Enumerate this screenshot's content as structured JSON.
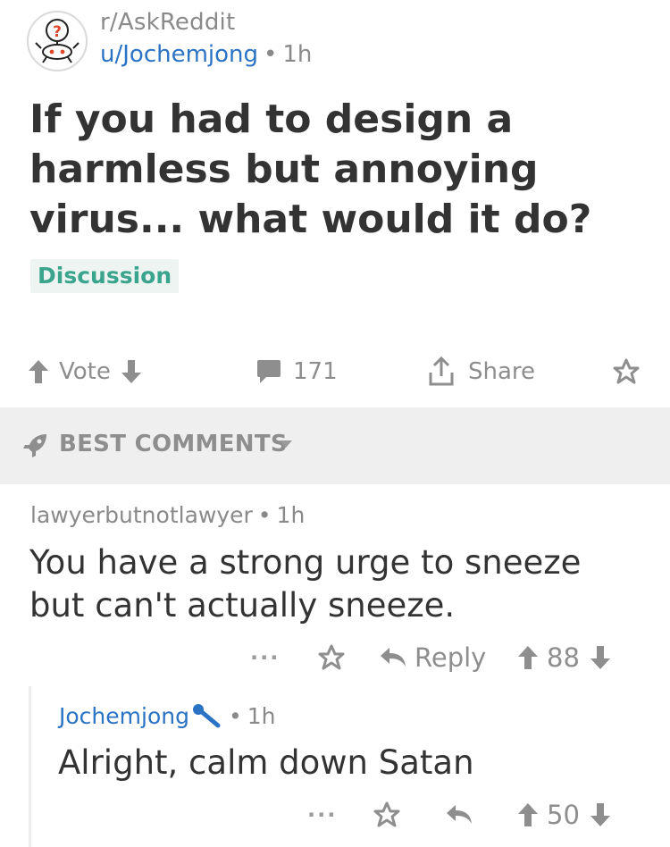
{
  "post": {
    "subreddit": "r/AskReddit",
    "author": "u/Jochemjong",
    "separator": "•",
    "age": "1h",
    "title": "If you had to design a harmless but annoying virus... what would it do?",
    "flair": "Discussion",
    "avatar_icon": "askreddit-snoo-icon"
  },
  "actions": {
    "vote_label": "Vote",
    "comment_count": "171",
    "share_label": "Share"
  },
  "sort": {
    "label": "BEST COMMENTS"
  },
  "comments": [
    {
      "author": "lawyerbutnotlawyer",
      "separator": "•",
      "age": "1h",
      "body": "You have a strong urge to sneeze but can't actually sneeze.",
      "more": "···",
      "reply_label": "Reply",
      "score": "88"
    },
    {
      "author": "Jochemjong",
      "separator": "•",
      "age": "1h",
      "body": "Alright, calm down Satan",
      "more": "···",
      "score": "50",
      "op_badge_icon": "microphone-icon"
    }
  ],
  "colors": {
    "link_blue": "#2b73c4",
    "flair_green": "#3aa48d",
    "icon_gray": "#8e8e8e",
    "band_gray": "#efefef"
  }
}
